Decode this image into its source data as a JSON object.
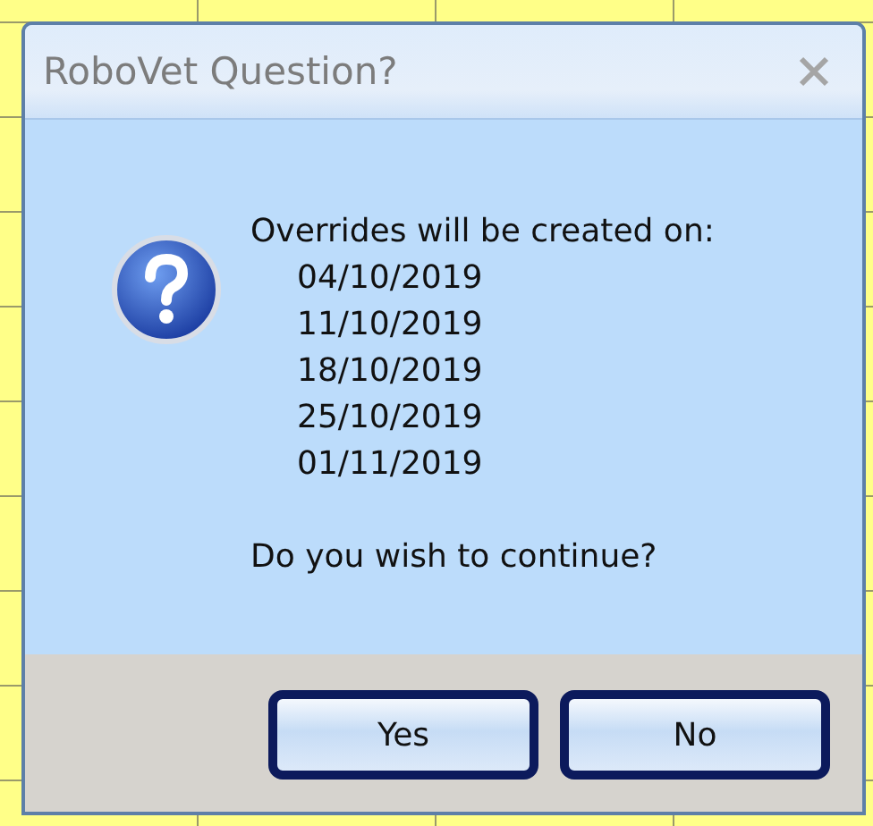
{
  "window": {
    "title": "RoboVet Question?"
  },
  "message": {
    "intro": "Overrides will be created on:",
    "dates": [
      "04/10/2019",
      "11/10/2019",
      "18/10/2019",
      "25/10/2019",
      "01/11/2019"
    ],
    "question": "Do you wish to continue?"
  },
  "buttons": [
    "Yes",
    "No"
  ]
}
